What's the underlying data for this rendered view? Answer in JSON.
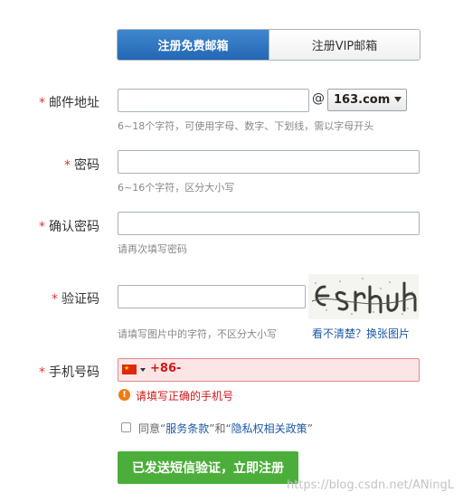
{
  "tabs": {
    "free": "注册免费邮箱",
    "vip": "注册VIP邮箱"
  },
  "required_mark": "*",
  "email": {
    "label": "邮件地址",
    "at": "@",
    "domain": "163.com",
    "hint": "6~18个字符，可使用字母、数字、下划线，需以字母开头"
  },
  "password": {
    "label": "密码",
    "hint": "6~16个字符，区分大小写"
  },
  "confirm_password": {
    "label": "确认密码",
    "hint": "请再次填写密码"
  },
  "captcha": {
    "label": "验证码",
    "hint": "请填写图片中的字符，不区分大小写",
    "refresh_link": "看不清楚？换张图片"
  },
  "phone": {
    "label": "手机号码",
    "country_code": "+86-",
    "error_icon": "!",
    "error": "请填写正确的手机号"
  },
  "agreement": {
    "prefix": "同意“",
    "terms": "服务条款",
    "middle": "”和“",
    "privacy": "隐私权相关政策",
    "suffix": "”"
  },
  "submit_label": "已发送短信验证，立即注册",
  "watermark": "https://blog.csdn.net/ANingL",
  "colors": {
    "accent_blue": "#2467b4",
    "error_red": "#d01818",
    "submit_green": "#4cae3a"
  }
}
